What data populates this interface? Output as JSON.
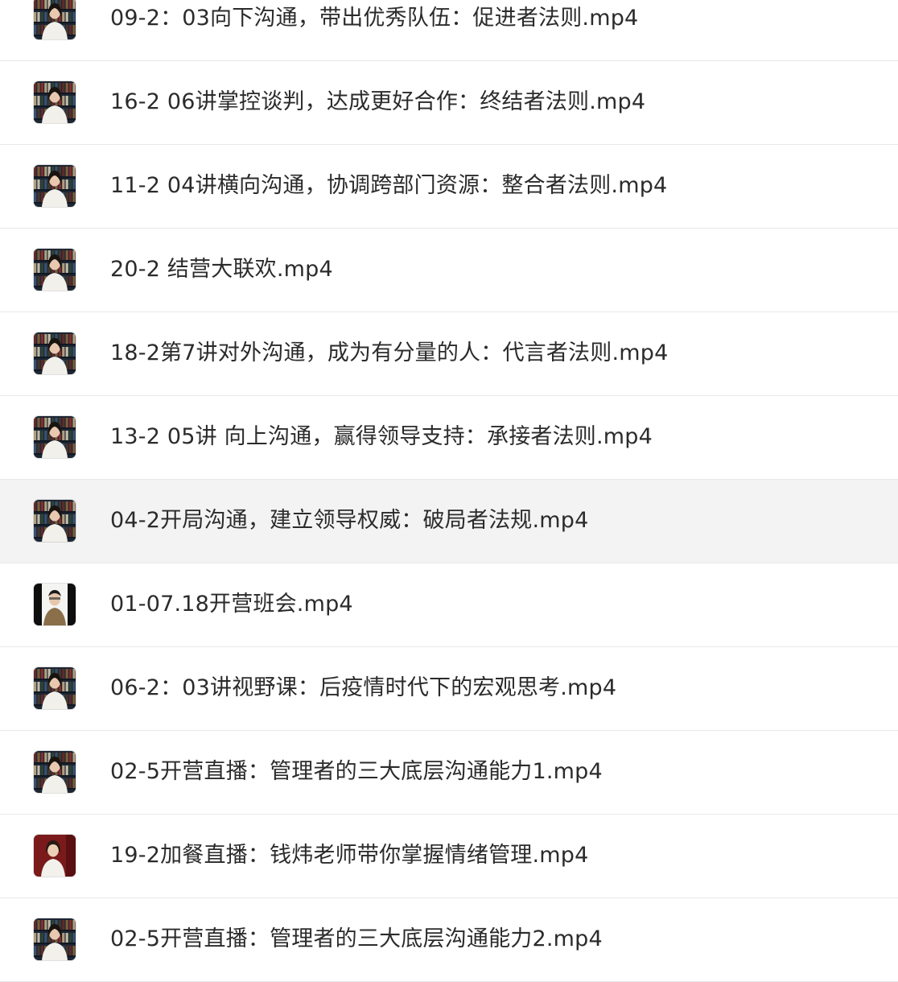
{
  "files": [
    {
      "name": "09-2：03向下沟通，带出优秀队伍：促进者法则.mp4",
      "thumb": "bookshelf-presenter-icon"
    },
    {
      "name": "16-2 06讲掌控谈判，达成更好合作：终结者法则.mp4",
      "thumb": "bookshelf-presenter-icon"
    },
    {
      "name": "11-2 04讲横向沟通，协调跨部门资源：整合者法则.mp4",
      "thumb": "bookshelf-presenter-icon"
    },
    {
      "name": "20-2 结营大联欢.mp4",
      "thumb": "bookshelf-presenter-icon"
    },
    {
      "name": "18-2第7讲对外沟通，成为有分量的人：代言者法则.mp4",
      "thumb": "bookshelf-presenter-icon"
    },
    {
      "name": "13-2 05讲 向上沟通，赢得领导支持：承接者法则.mp4",
      "thumb": "bookshelf-presenter-icon"
    },
    {
      "name": "04-2开局沟通，建立领导权威：破局者法规.mp4",
      "thumb": "bookshelf-presenter-icon",
      "selected": true
    },
    {
      "name": "01-07.18开营班会.mp4",
      "thumb": "dark-presenter-icon"
    },
    {
      "name": "06-2：03讲视野课：后疫情时代下的宏观思考.mp4",
      "thumb": "bookshelf-presenter-icon"
    },
    {
      "name": "02-5开营直播：管理者的三大底层沟通能力1.mp4",
      "thumb": "bookshelf-presenter-icon"
    },
    {
      "name": "19-2加餐直播：钱炜老师带你掌握情绪管理.mp4",
      "thumb": "red-backdrop-presenter-icon"
    },
    {
      "name": "02-5开营直播：管理者的三大底层沟通能力2.mp4",
      "thumb": "bookshelf-presenter-icon"
    }
  ],
  "colors": {
    "row_border": "#e8e8ea",
    "selected_bg": "#f3f3f3",
    "text": "#2b2b2b",
    "shelf_dark": "#1d2633",
    "backdrop_red": "#7a1a1a"
  }
}
